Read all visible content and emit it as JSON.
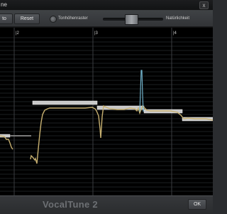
{
  "window": {
    "title": "ne",
    "close_glyph": "x"
  },
  "toolbar": {
    "auto_label": "to",
    "reset_label": "Reset",
    "pitch_grid_label": "Tonhöhenraster",
    "naturalness_label": "Natürlichkeit",
    "naturalness_value": 0.45
  },
  "editor": {
    "measure_markers": [
      {
        "label": "|2",
        "beat": 1
      },
      {
        "label": "|3",
        "beat": 2
      },
      {
        "label": "|4",
        "beat": 3
      }
    ],
    "colors": {
      "background": "#000000",
      "row_line": "#1d2022",
      "beat_line": "#3a3d40",
      "note_block": "#c8c8c8",
      "pitch_curve": "#c7b070",
      "pitch_spike": "#6fb0c8"
    }
  },
  "bottom": {
    "brand": "VocalTune 2",
    "ok_label": "OK"
  }
}
